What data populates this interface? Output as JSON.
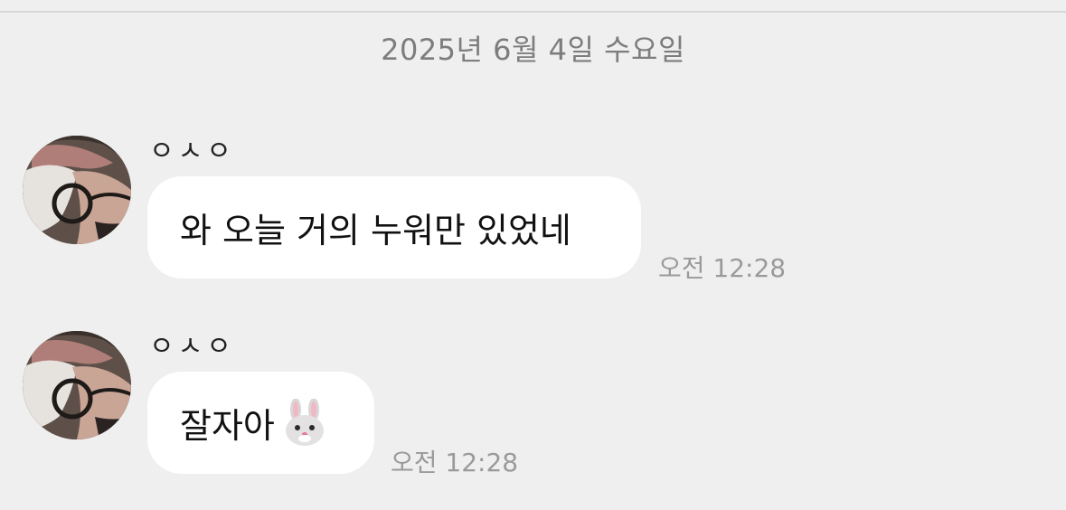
{
  "date_separator": "2025년 6월 4일 수요일",
  "messages": [
    {
      "sender": "ㅇㅅㅇ",
      "text": "와 오늘 거의 누워만 있었네",
      "time": "오전 12:28",
      "avatar_icon": "profile-photo"
    },
    {
      "sender": "ㅇㅅㅇ",
      "text": "잘자아",
      "emoji_icon": "rabbit-face-icon",
      "time": "오전 12:28",
      "avatar_icon": "profile-photo"
    }
  ],
  "colors": {
    "background": "#efefef",
    "bubble": "#ffffff",
    "timestamp": "#9a9a9a",
    "date_text": "#7d7d7d"
  }
}
